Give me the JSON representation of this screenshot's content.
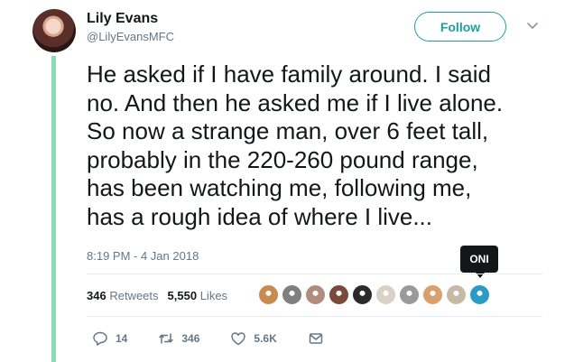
{
  "author": {
    "name": "Lily Evans",
    "handle": "@LilyEvansMFC"
  },
  "follow_label": "Follow",
  "tweet_text": "He asked if I have family around. I said\nno. And then he asked me if I live alone.\nSo now a strange man, over 6 feet tall,\nprobably in the 220-260 pound range,\nhas been watching me, following me,\nhas a rough idea of where I live...",
  "timestamp": "8:19 PM - 4 Jan 2018",
  "tooltip": "ONI",
  "stats": {
    "retweets_count": "346",
    "retweets_label": "Retweets",
    "likes_count": "5,550",
    "likes_label": "Likes"
  },
  "actions": {
    "reply_count": "14",
    "retweet_count": "346",
    "like_count": "5.6K"
  },
  "colors": {
    "accent": "#1da1a0",
    "thread_line": "#8fdcb3",
    "muted": "#657786"
  },
  "liker_colors": [
    "#c98a4e",
    "#7f7f7f",
    "#b08c7c",
    "#7a4b3a",
    "#2b2b2b",
    "#d8d2c6",
    "#9a9a9a",
    "#d9a06b",
    "#c7b9a4",
    "#2b9ac7"
  ]
}
